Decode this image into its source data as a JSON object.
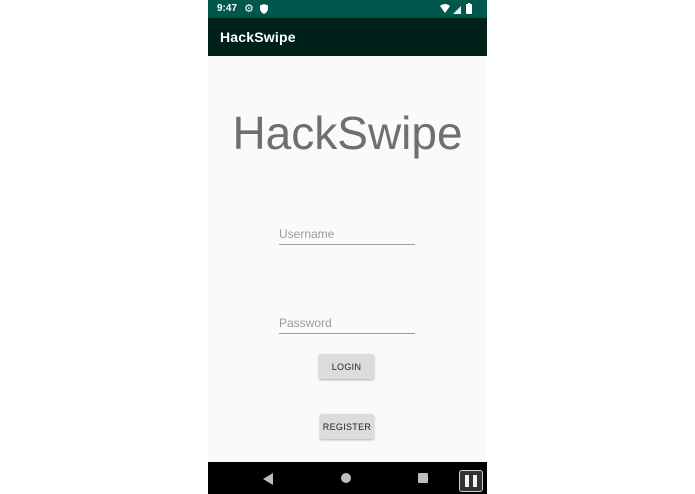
{
  "status_bar": {
    "time": "9:47",
    "icons": [
      "gear-icon",
      "shield-icon",
      "wifi-icon",
      "signal-icon",
      "battery-icon"
    ],
    "color": "#00574b"
  },
  "app_bar": {
    "title": "HackSwipe",
    "color": "#00201a"
  },
  "main": {
    "hero_title": "HackSwipe",
    "username": {
      "value": "",
      "placeholder": "Username"
    },
    "password": {
      "value": "",
      "placeholder": "Password"
    },
    "login_label": "LOGIN",
    "register_label": "REGISTER"
  },
  "nav_bar": {
    "icons": [
      "back-icon",
      "home-icon",
      "recents-icon",
      "pause-icon"
    ]
  }
}
